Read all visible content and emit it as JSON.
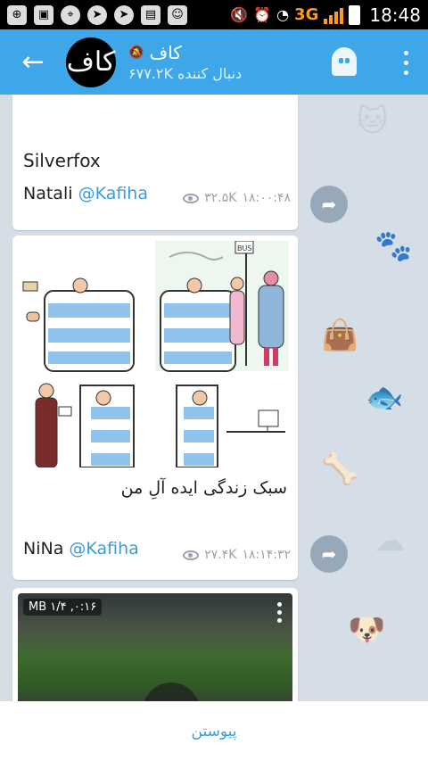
{
  "status_bar": {
    "time": "18:48",
    "network": "3G"
  },
  "header": {
    "back_icon": "arrow-left-icon",
    "avatar_text": "کاف",
    "title": "کاف",
    "subtitle": "۶۷۷.۲K دنبال کننده",
    "mute_icon": "mute-icon",
    "ghost_icon": "ghost-icon",
    "menu_icon": "more-vertical-icon"
  },
  "messages": [
    {
      "text": "Silverfox",
      "signature_name": "Natali",
      "signature_handle": "@Kafiha",
      "views": "۳۲.۵K",
      "time": "۱۸:۰۰:۴۸"
    },
    {
      "caption": "سبک زندگی ایده آلِ من",
      "signature_name": "NiNa",
      "signature_handle": "@Kafiha",
      "views": "۲۷.۴K",
      "time": "۱۸:۱۴:۳۲",
      "comic_sign": "BUS"
    },
    {
      "video_badge": "۰:۱۶, ۱/۴ MB"
    }
  ],
  "bottom": {
    "join_label": "پیوستن"
  }
}
